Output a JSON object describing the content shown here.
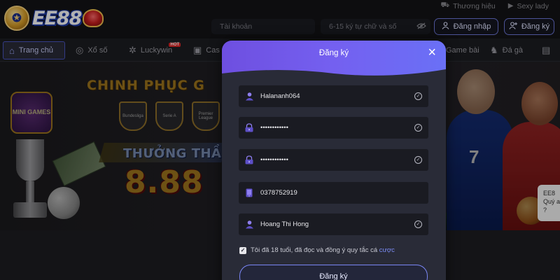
{
  "brand": {
    "logo_text": "EE88"
  },
  "header": {
    "links": [
      {
        "label": "Thương hiệu",
        "icon": "car-icon"
      },
      {
        "label": "Sexy lady",
        "icon": "play-icon"
      }
    ],
    "username_placeholder": "Tài khoản",
    "password_placeholder": "6-15 ký tự chữ và số",
    "login_label": "Đăng nhập",
    "register_label": "Đăng ký"
  },
  "nav": {
    "items": [
      {
        "label": "Trang chủ",
        "icon": "home-icon"
      },
      {
        "label": "Xổ số",
        "icon": "lottery-icon"
      },
      {
        "label": "Luckywin",
        "icon": "wheel-icon",
        "tag": "HOT"
      },
      {
        "label": "Cas",
        "icon": "casino-icon"
      },
      {
        "label": "Game bài",
        "icon": "cards-icon"
      },
      {
        "label": "Đá gà",
        "icon": "rooster-icon"
      }
    ]
  },
  "banner": {
    "title": "CHINH PHỤC G",
    "subtitle": "THƯỞNG THẦ",
    "amount": "8.88",
    "badge": "MINI GAMES",
    "leagues": [
      "Bundesliga",
      "Serie A",
      "Premier League"
    ],
    "player_number": "7",
    "chat_tip": "EE8 Quý a ?"
  },
  "modal": {
    "title": "Đăng ký",
    "fields": [
      {
        "name": "username",
        "value": "Halananh064",
        "icon": "user-icon"
      },
      {
        "name": "password",
        "value": "••••••••••••",
        "icon": "lock-icon"
      },
      {
        "name": "confirm_password",
        "value": "••••••••••••",
        "icon": "lock-icon"
      },
      {
        "name": "phone",
        "value": "0378752919",
        "icon": "phone-icon"
      },
      {
        "name": "full_name",
        "value": "Hoang Thi Hong",
        "icon": "user-icon"
      }
    ],
    "terms_text": "Tôi đã 18 tuổi, đã đọc và đồng ý quy tắc cá",
    "terms_link": "cược",
    "submit_label": "Đăng ký"
  },
  "colors": {
    "accent": "#6e5ce8",
    "accent_border": "#7a86f4",
    "field_bg": "#1a1b22",
    "modal_bg": "#292b37"
  }
}
